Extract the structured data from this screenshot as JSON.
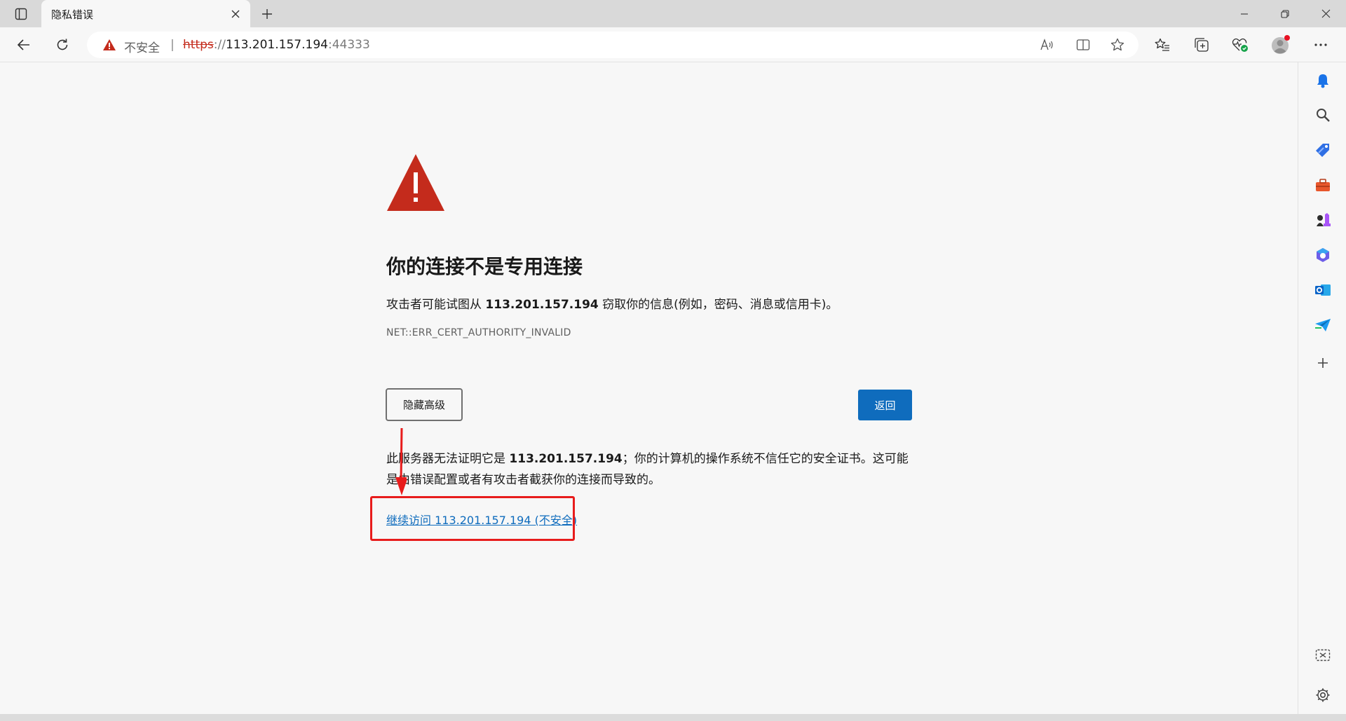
{
  "tab": {
    "title": "隐私错误"
  },
  "omnibox": {
    "security_label": "不安全",
    "separator": "|",
    "url_scheme": "https",
    "url_sep": "://",
    "url_host": "113.201.157.194",
    "url_port": ":44333"
  },
  "page": {
    "heading": "你的连接不是专用连接",
    "desc_prefix": "攻击者可能试图从 ",
    "desc_host": "113.201.157.194",
    "desc_suffix": " 窃取你的信息(例如，密码、消息或信用卡)。",
    "error_code": "NET::ERR_CERT_AUTHORITY_INVALID",
    "hide_advanced_label": "隐藏高级",
    "back_label": "返回",
    "explain_prefix": "此服务器无法证明它是 ",
    "explain_host": "113.201.157.194",
    "explain_suffix": "；你的计算机的操作系统不信任它的安全证书。这可能是由错误配置或者有攻击者截获你的连接而导致的。",
    "proceed_link": "继续访问 113.201.157.194 (不安全)"
  },
  "colors": {
    "accent": "#0f6cbd",
    "warning": "#c42b1c",
    "annotation": "#e81c1c"
  }
}
